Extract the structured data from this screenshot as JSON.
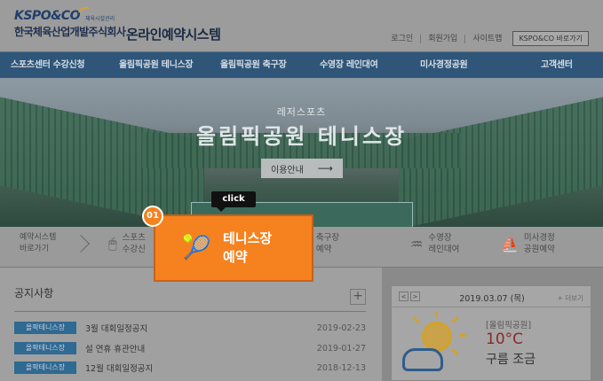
{
  "header": {
    "logo_en": "KSPO&CO",
    "logo_sub": "체육시설관리",
    "logo_kr": "한국체육산업개발주식회사",
    "system_title": "온라인예약시스템",
    "util_links": [
      "로그인",
      "회원가입",
      "사이트맵"
    ],
    "kspo_button": "KSPO&CO 바로가기"
  },
  "nav": {
    "items": [
      "스포츠센터 수강신청",
      "올림픽공원 테니스장",
      "올림픽공원 축구장",
      "수영장 레인대여",
      "미사경정공원",
      "고객센터"
    ]
  },
  "hero": {
    "subtitle": "레저스포츠",
    "title": "올림픽공원 테니스장",
    "info_button": "이용안내",
    "info_arrow": "⟶"
  },
  "quick": {
    "label_line1": "예약시스템",
    "label_line2": "바로가기",
    "items": [
      {
        "icon": "🖱",
        "line1": "스포츠",
        "line2": "수강신"
      },
      {
        "icon": "⚽",
        "line1": "축구장",
        "line2": "예약"
      },
      {
        "icon": "♒",
        "line1": "수영장",
        "line2": "레인대여"
      },
      {
        "icon": "⛵",
        "line1": "미사경정",
        "line2": "공원예약"
      }
    ]
  },
  "highlight": {
    "icon": "🎾",
    "line1": "테니스장",
    "line2": "예약",
    "badge": "01",
    "tooltip": "click"
  },
  "notice": {
    "title": "공지사항",
    "plus": "+",
    "rows": [
      {
        "tag": "올팍테니스장",
        "text": "3월 대회일정공지",
        "date": "2019-02-23"
      },
      {
        "tag": "올팍테니스장",
        "text": "설 연휴 휴관안내",
        "date": "2019-01-27"
      },
      {
        "tag": "올팍테니스장",
        "text": "12월 대회일정공지",
        "date": "2018-12-13"
      }
    ]
  },
  "weather": {
    "prev": "<",
    "next": ">",
    "date": "2019.03.07 (목)",
    "more": "+ 더보기",
    "location": "[올림픽공원]",
    "temperature": "10°C",
    "condition": "구름 조금"
  }
}
